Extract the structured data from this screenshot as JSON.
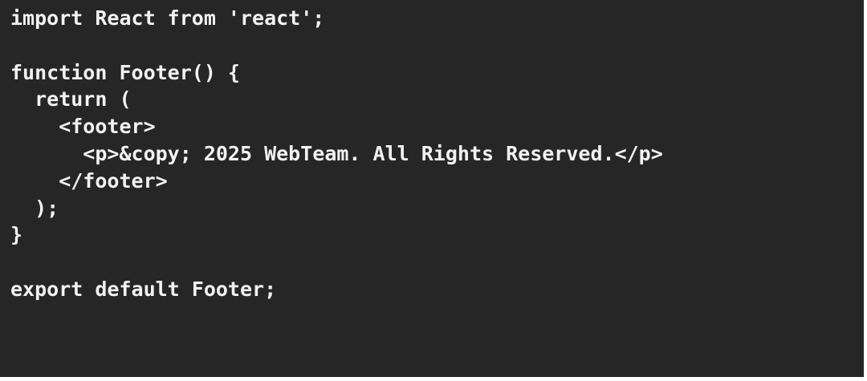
{
  "editor": {
    "lines": [
      "import React from 'react';",
      "",
      "function Footer() {",
      "  return (",
      "    <footer>",
      "      <p>&copy; 2025 WebTeam. All Rights Reserved.</p>",
      "    </footer>",
      "  );",
      "}",
      "",
      "export default Footer;"
    ]
  },
  "colors": {
    "background": "#262626",
    "text": "#f2f2f2"
  }
}
